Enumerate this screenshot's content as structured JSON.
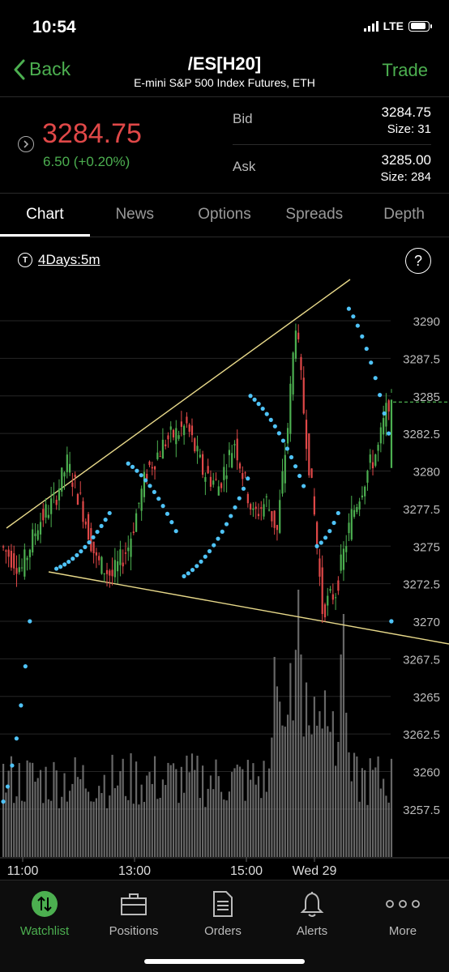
{
  "status": {
    "time": "10:54",
    "network": "LTE",
    "battery_level": 0.9
  },
  "nav": {
    "back_label": "Back",
    "title": "/ES[H20]",
    "subtitle": "E-mini S&P 500 Index Futures, ETH",
    "action_label": "Trade"
  },
  "quote": {
    "last": "3284.75",
    "change": "6.50 (+0.20%)",
    "bid_label": "Bid",
    "bid_price": "3284.75",
    "bid_size": "Size: 31",
    "ask_label": "Ask",
    "ask_price": "3285.00",
    "ask_size": "Size: 284",
    "colors": {
      "down": "#e04848",
      "up": "#4caf50"
    }
  },
  "tabs": [
    {
      "label": "Chart",
      "active": true
    },
    {
      "label": "News",
      "active": false
    },
    {
      "label": "Options",
      "active": false
    },
    {
      "label": "Spreads",
      "active": false
    },
    {
      "label": "Depth",
      "active": false
    }
  ],
  "chart_controls": {
    "period_icon": "T",
    "period_label": "4Days:5m",
    "help_label": "?"
  },
  "chart_data": {
    "type": "candlestick",
    "x_tick_labels": [
      "11:00",
      "13:00",
      "15:00",
      "Wed 29"
    ],
    "y_tick_labels": [
      "3290",
      "3287.5",
      "3285",
      "3282.5",
      "3280",
      "3277.5",
      "3275",
      "3272.5",
      "3270",
      "3267.5",
      "3265",
      "3262.5",
      "3260",
      "3257.5"
    ],
    "ylim": [
      3256,
      3292
    ],
    "last_price_marker": 3284.75,
    "colors": {
      "up": "#4caf50",
      "down": "#e04848",
      "psar": "#4fc3f7",
      "trendline": "#e8d98a",
      "volume": "#8a8a8a",
      "grid": "#262626"
    }
  },
  "tabbar": [
    {
      "label": "Watchlist",
      "icon": "watchlist-icon",
      "active": true
    },
    {
      "label": "Positions",
      "icon": "briefcase-icon",
      "active": false
    },
    {
      "label": "Orders",
      "icon": "document-icon",
      "active": false
    },
    {
      "label": "Alerts",
      "icon": "bell-icon",
      "active": false
    },
    {
      "label": "More",
      "icon": "more-dots-icon",
      "active": false
    }
  ]
}
